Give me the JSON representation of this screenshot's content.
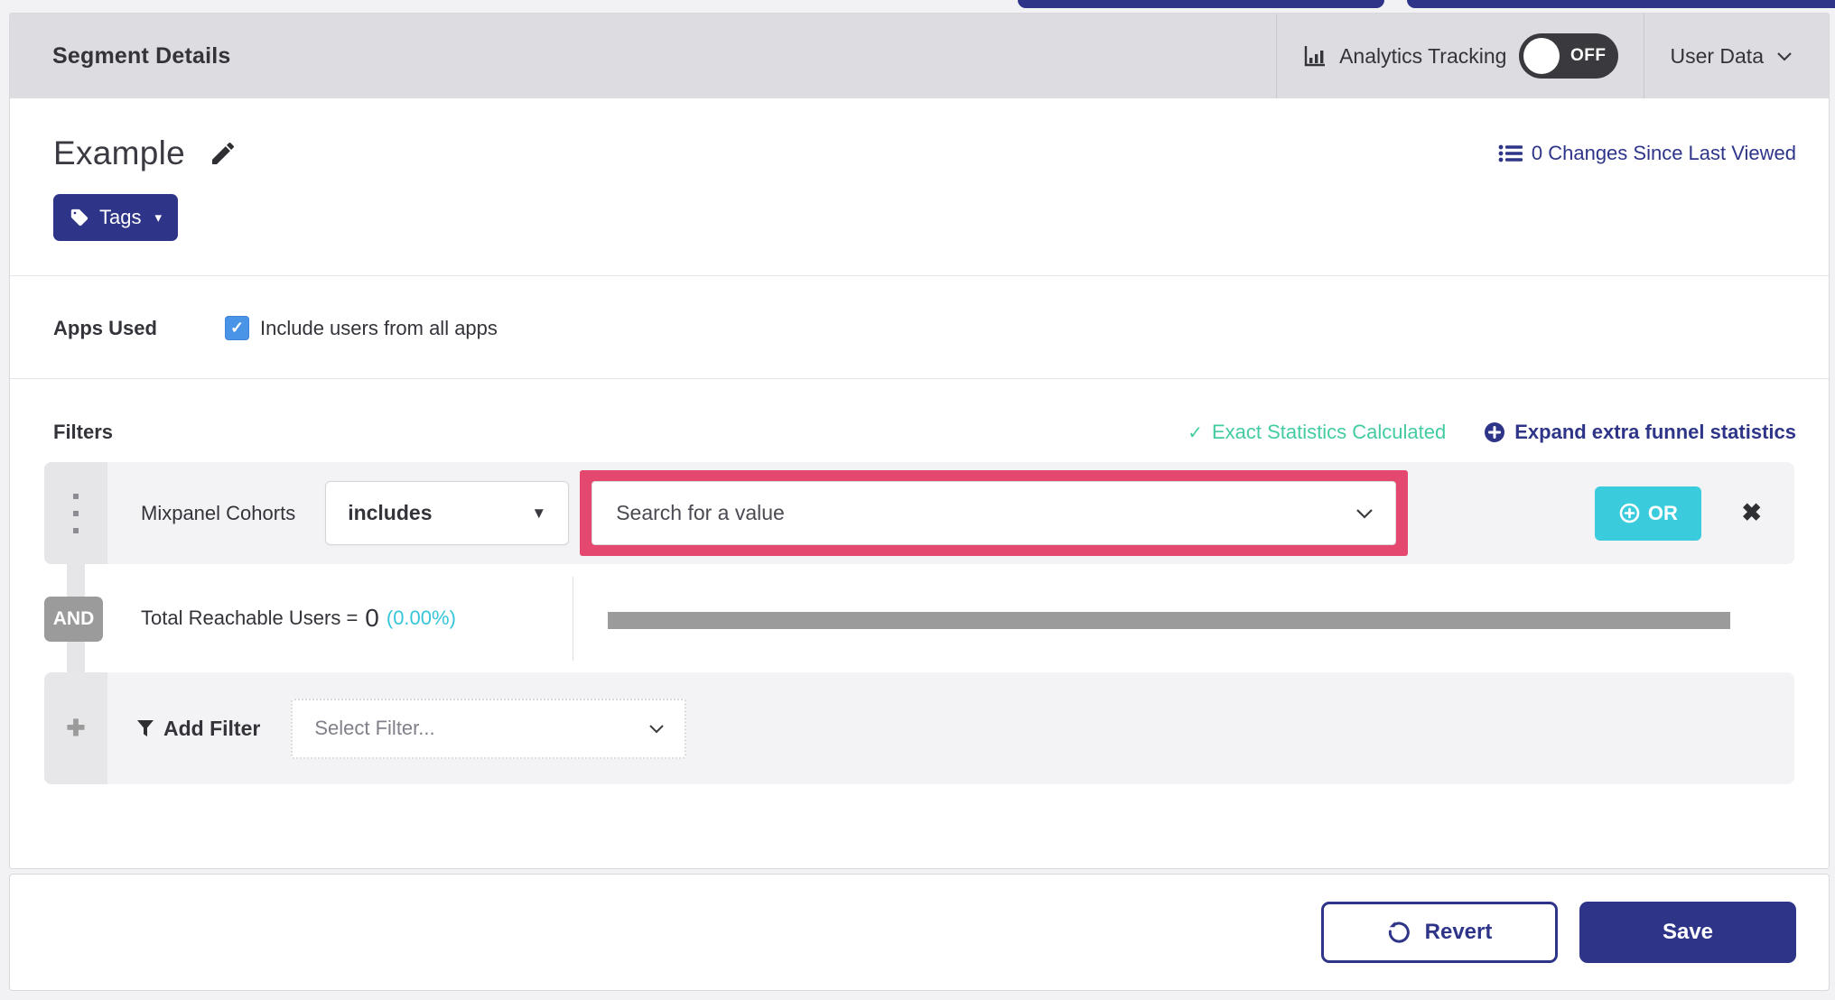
{
  "header": {
    "title": "Segment Details",
    "analytics_label": "Analytics Tracking",
    "toggle_state": "OFF",
    "user_data_label": "User Data"
  },
  "segment": {
    "name": "Example",
    "changes_link": "0 Changes Since Last Viewed",
    "tags_label": "Tags"
  },
  "apps_used": {
    "label": "Apps Used",
    "checkbox_label": "Include users from all apps",
    "checked": true
  },
  "filters": {
    "title": "Filters",
    "exact_stats_label": "Exact Statistics Calculated",
    "expand_link_label": "Expand extra funnel statistics",
    "filter_row": {
      "field": "Mixpanel Cohorts",
      "operator": "includes",
      "value_placeholder": "Search for a value",
      "or_label": "OR"
    },
    "and_label": "AND",
    "total_reachable": {
      "label": "Total Reachable Users =",
      "value": "0",
      "percent": "(0.00%)"
    },
    "add_filter": {
      "label": "Add Filter",
      "select_placeholder": "Select Filter..."
    }
  },
  "footer": {
    "revert_label": "Revert",
    "save_label": "Save"
  },
  "icons": {
    "check": "✓",
    "checkbox_check": "✓",
    "caret_down": "▾",
    "triangle_down": "▼",
    "close": "✖",
    "plus": "✚"
  },
  "colors": {
    "primary_blue": "#2e3589",
    "teal": "#3accdd",
    "pink_highlight": "#e5486e",
    "green_success": "#43cba2",
    "checkbox_blue": "#4a94e8",
    "neutral_gray": "#9b9b9b"
  }
}
